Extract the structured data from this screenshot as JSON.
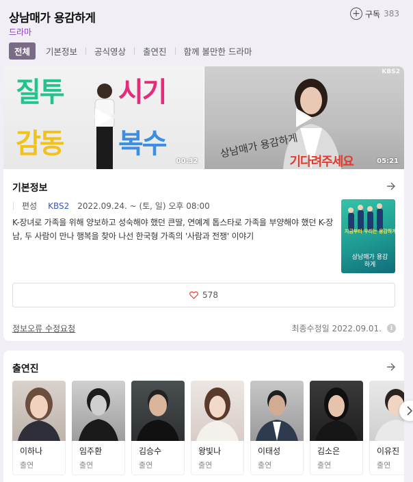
{
  "header": {
    "title": "상남매가 용감하게",
    "genre": "드라마",
    "subscribe_label": "구독",
    "subscribe_count": "383"
  },
  "tabs": [
    {
      "label": "전체",
      "active": true
    },
    {
      "label": "기본정보",
      "active": false
    },
    {
      "label": "공식영상",
      "active": false
    },
    {
      "label": "출연진",
      "active": false
    },
    {
      "label": "함께 볼만한 드라마",
      "active": false
    }
  ],
  "videos": [
    {
      "duration": "00:32",
      "overlay_text": [
        "질투",
        "시기",
        "감동",
        "복수"
      ]
    },
    {
      "duration": "05:21",
      "channel": "KBS2",
      "overlay_text": "기다려주세요",
      "logo_text": "상남매가 용감하게"
    }
  ],
  "basic_info": {
    "section_title": "기본정보",
    "status": "편성",
    "channel": "KBS2",
    "schedule": "2022.09.24. ~  (토, 일) 오후 08:00",
    "description": "K-장녀로 가족을 위해 양보하고 성숙해야 했던 큰딸, 연예계 톱스타로 가족을 부양해야 했던 K-장남, 두 사람이 만나 행복을 찾아 나선 한국형 가족의 '사람과 전쟁' 이야기",
    "like_count": "578",
    "report_link": "정보오류 수정요청",
    "updated": "최종수정일 2022.09.01.",
    "poster_text": "지금부터 우리는 용감하게",
    "poster_title": "상남매가 용감하게"
  },
  "cast_section": {
    "section_title": "출연진",
    "members": [
      {
        "name": "이하나",
        "role": "출연"
      },
      {
        "name": "임주환",
        "role": "출연"
      },
      {
        "name": "김승수",
        "role": "출연"
      },
      {
        "name": "왕빛나",
        "role": "출연"
      },
      {
        "name": "이태성",
        "role": "출연"
      },
      {
        "name": "김소은",
        "role": "출연"
      },
      {
        "name": "이유진",
        "role": "출연"
      }
    ]
  },
  "colors": {
    "accent_purple": "#8a3fbf",
    "tab_active_bg": "#7a6b86",
    "kbs_blue": "#3a57c4",
    "heart_red": "#e0413b"
  }
}
